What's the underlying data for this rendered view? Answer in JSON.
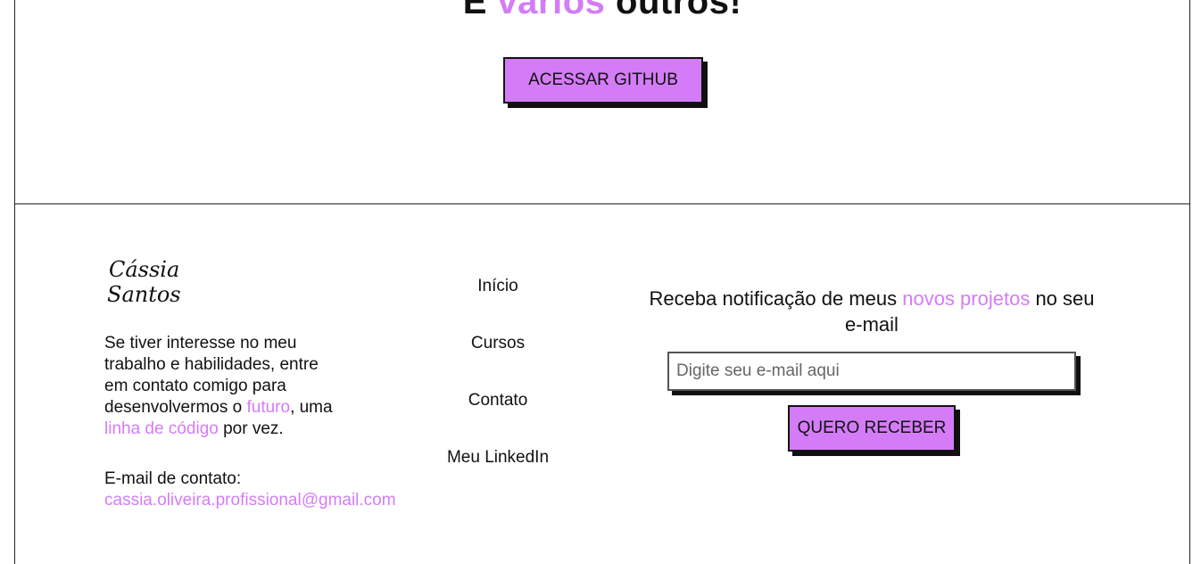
{
  "hero": {
    "title_prefix": "E",
    "title_accent": "vários",
    "title_suffix": "outros!",
    "github_button": "ACESSAR GITHUB"
  },
  "footer": {
    "logo_line1": "Cássia",
    "logo_line2": "Santos",
    "about": {
      "part1": "Se tiver interesse no meu trabalho e habilidades, entre em contato comigo para desenvolvermos o ",
      "accent1": "futuro",
      "part2": ", uma ",
      "accent2": "linha de código",
      "part3": " por vez."
    },
    "contact_label": "E-mail de contato:",
    "contact_email": "cassia.oliveira.profissional@gmail.com",
    "nav": [
      {
        "label": "Início"
      },
      {
        "label": "Cursos"
      },
      {
        "label": "Contato"
      },
      {
        "label": "Meu LinkedIn"
      }
    ],
    "newsletter": {
      "text1": "Receba notificação de meus ",
      "accent": "novos projetos",
      "text2": " no seu e-mail",
      "placeholder": "Digite seu e-mail aqui",
      "button": "QUERO RECEBER"
    }
  },
  "colors": {
    "accent": "#d47cf7",
    "border": "#222222"
  }
}
